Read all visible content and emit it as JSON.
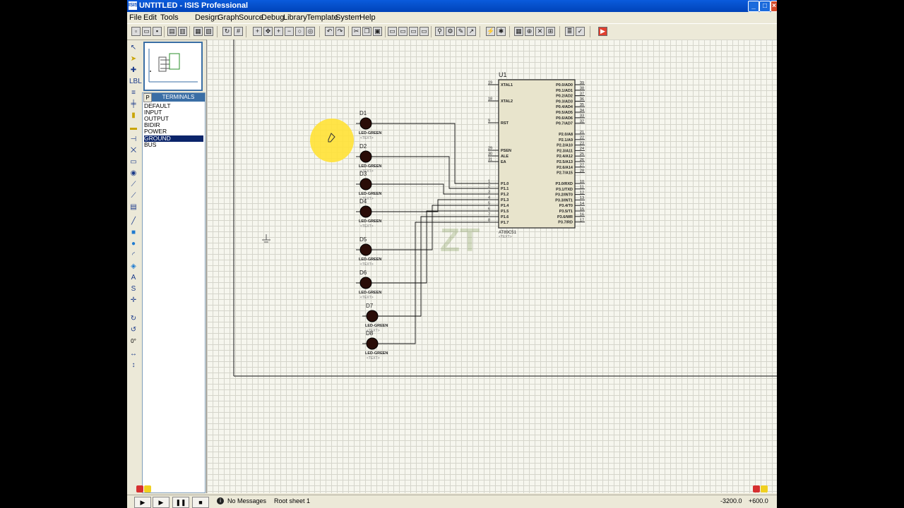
{
  "window": {
    "title": "UNTITLED - ISIS Professional",
    "app_icon": "ISIS"
  },
  "menu": [
    "File",
    "Edit",
    "Tools",
    "Design",
    "Graph",
    "Source",
    "Debug",
    "Library",
    "Template",
    "System",
    "Help"
  ],
  "device_panel": {
    "mode_button": "P",
    "header": "TERMINALS",
    "items": [
      "DEFAULT",
      "INPUT",
      "OUTPUT",
      "BIDIR",
      "POWER",
      "GROUND",
      "BUS"
    ],
    "selected": "GROUND"
  },
  "left_tool": {
    "rotation": "0°"
  },
  "schematic": {
    "mcu": {
      "ref": "U1",
      "part": "AT89C51",
      "text_placeholder": "<TEXT>",
      "left_pins": [
        {
          "num": "19",
          "name": "XTAL1"
        },
        {
          "num": "18",
          "name": "XTAL2"
        },
        {
          "num": "9",
          "name": "RST"
        },
        {
          "num": "29",
          "name": "PSEN"
        },
        {
          "num": "30",
          "name": "ALE"
        },
        {
          "num": "31",
          "name": "EA"
        },
        {
          "num": "1",
          "name": "P1.0"
        },
        {
          "num": "2",
          "name": "P1.1"
        },
        {
          "num": "3",
          "name": "P1.2"
        },
        {
          "num": "4",
          "name": "P1.3"
        },
        {
          "num": "5",
          "name": "P1.4"
        },
        {
          "num": "6",
          "name": "P1.5"
        },
        {
          "num": "7",
          "name": "P1.6"
        },
        {
          "num": "8",
          "name": "P1.7"
        }
      ],
      "right_pins": [
        {
          "num": "39",
          "name": "P0.0/AD0"
        },
        {
          "num": "38",
          "name": "P0.1/AD1"
        },
        {
          "num": "37",
          "name": "P0.2/AD2"
        },
        {
          "num": "36",
          "name": "P0.3/AD3"
        },
        {
          "num": "35",
          "name": "P0.4/AD4"
        },
        {
          "num": "34",
          "name": "P0.5/AD5"
        },
        {
          "num": "33",
          "name": "P0.6/AD6"
        },
        {
          "num": "32",
          "name": "P0.7/AD7"
        },
        {
          "num": "21",
          "name": "P2.0/A8"
        },
        {
          "num": "22",
          "name": "P2.1/A9"
        },
        {
          "num": "23",
          "name": "P2.2/A10"
        },
        {
          "num": "24",
          "name": "P2.3/A11"
        },
        {
          "num": "25",
          "name": "P2.4/A12"
        },
        {
          "num": "26",
          "name": "P2.5/A13"
        },
        {
          "num": "27",
          "name": "P2.6/A14"
        },
        {
          "num": "28",
          "name": "P2.7/A15"
        },
        {
          "num": "10",
          "name": "P3.0/RXD"
        },
        {
          "num": "11",
          "name": "P3.1/TXD"
        },
        {
          "num": "12",
          "name": "P3.2/INT0"
        },
        {
          "num": "13",
          "name": "P3.3/INT1"
        },
        {
          "num": "14",
          "name": "P3.4/T0"
        },
        {
          "num": "15",
          "name": "P3.5/T1"
        },
        {
          "num": "16",
          "name": "P3.6/WR"
        },
        {
          "num": "17",
          "name": "P3.7/RD"
        }
      ]
    },
    "leds": [
      {
        "ref": "D1",
        "part": "LED-GREEN",
        "text": "<TEXT>"
      },
      {
        "ref": "D2",
        "part": "LED-GREEN",
        "text": "<TEXT>"
      },
      {
        "ref": "D3",
        "part": "LED-GREEN",
        "text": "<TEXT>"
      },
      {
        "ref": "D4",
        "part": "LED-GREEN",
        "text": "<TEXT>"
      },
      {
        "ref": "D5",
        "part": "LED-GREEN",
        "text": "<TEXT>"
      },
      {
        "ref": "D6",
        "part": "LED-GREEN",
        "text": "<TEXT>"
      },
      {
        "ref": "D7",
        "part": "LED-GREEN",
        "text": "<TEXT>"
      },
      {
        "ref": "D8",
        "part": "LED-GREEN",
        "text": "<TEXT>"
      }
    ],
    "colors": {
      "led_body": "#2a0d08",
      "mcu_body": "#e8e4cc",
      "wire": "#111111",
      "cursor_highlight": "#ffe23a"
    }
  },
  "status": {
    "messages": "No Messages",
    "sheet": "Root sheet 1",
    "coord_x": "-3200.0",
    "coord_y": "+600.0"
  }
}
